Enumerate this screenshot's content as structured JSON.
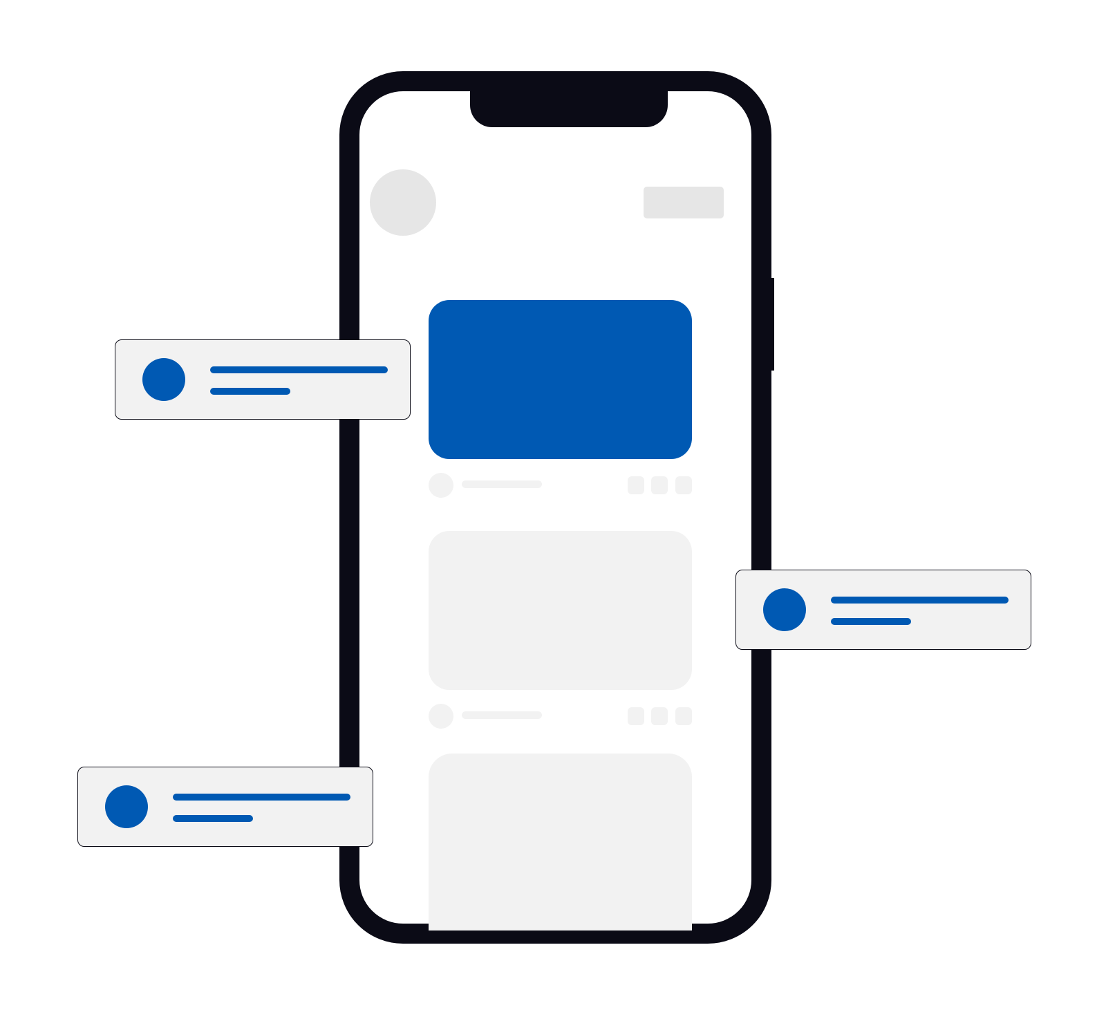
{
  "colors": {
    "frame": "#0b0b16",
    "accent": "#0059b3",
    "placeholder_light": "#f2f2f2",
    "placeholder_mid": "#e6e6e6",
    "background": "#ffffff"
  },
  "phone": {
    "feed": {
      "posts": [
        {
          "media_highlighted": true,
          "actions": [
            "action-1",
            "action-2",
            "action-3"
          ]
        },
        {
          "media_highlighted": false,
          "actions": [
            "action-1",
            "action-2",
            "action-3"
          ]
        },
        {
          "media_highlighted": false
        }
      ]
    }
  },
  "notifications": [
    {
      "icon": "avatar-icon",
      "side": "left"
    },
    {
      "icon": "avatar-icon",
      "side": "right"
    },
    {
      "icon": "avatar-icon",
      "side": "left"
    }
  ]
}
